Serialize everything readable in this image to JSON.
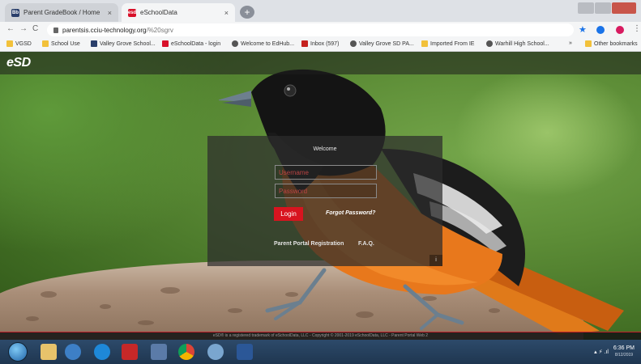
{
  "browser": {
    "tabs": [
      {
        "title": "Parent GradeBook / Home",
        "favicon": "Bb",
        "active": false
      },
      {
        "title": "eSchoolData",
        "favicon": "esd",
        "active": true
      }
    ],
    "close_glyph": "×",
    "new_tab_glyph": "+",
    "address": {
      "host": "parentsis.cciu-technology.org",
      "path": "/%20sgrv"
    },
    "nav": {
      "back": "←",
      "forward": "→",
      "reload": "C"
    },
    "star_glyph": "★",
    "menu_glyph": "⋮",
    "bookmarks": [
      {
        "label": "VGSD",
        "color": "#f2c13a"
      },
      {
        "label": "School Use",
        "color": "#f2c13a"
      },
      {
        "label": "Valley Grove School...",
        "color": "#2a3f6b"
      },
      {
        "label": "eSchoolData - login",
        "color": "#d8102a"
      },
      {
        "label": "Welcome to EdHub...",
        "color": "#555555"
      },
      {
        "label": "Inbox (597)",
        "color": "#c5221f"
      },
      {
        "label": "Valley Grove SD PA...",
        "color": "#555555"
      },
      {
        "label": "Imported From IE",
        "color": "#f2c13a"
      },
      {
        "label": "Warhill High School...",
        "color": "#555555"
      }
    ],
    "bookmarks_overflow": "»",
    "other_bookmarks": "Other bookmarks"
  },
  "header": {
    "logo": "eSD"
  },
  "login": {
    "welcome": "Welcome",
    "username_placeholder": "Username",
    "password_placeholder": "Password",
    "login_label": "Login",
    "forgot_label": "Forgot Password?",
    "registration_label": "Parent Portal Registration",
    "faq_label": "F.A.Q.",
    "corner_glyph": "i"
  },
  "footer": {
    "text": "eSD® is a registered trademark of eSchoolData, LLC - Copyright © 2001-2019 eSchoolData, LLC - Parent Portal Web 2"
  },
  "taskbar": {
    "time": "6:36 PM",
    "date": "8/12/2019",
    "tray_glyphs": "▴  ⚡ .ıl"
  },
  "colors": {
    "accent_red": "#d8141f",
    "panel": "#2d2d2d"
  }
}
